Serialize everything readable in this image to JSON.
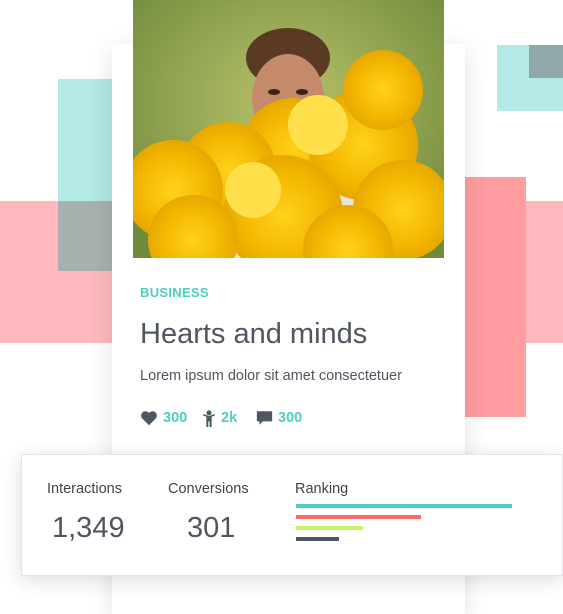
{
  "article": {
    "category": "BUSINESS",
    "title": "Hearts and minds",
    "subtitle": "Lorem ipsum dolor sit amet consectetuer",
    "stats": [
      {
        "icon": "heart-icon",
        "value": "300"
      },
      {
        "icon": "person-icon",
        "value": "2k"
      },
      {
        "icon": "comment-icon",
        "value": "300"
      }
    ]
  },
  "metrics": {
    "interactions_label": "Interactions",
    "interactions_value": "1,349",
    "conversions_label": "Conversions",
    "conversions_value": "301",
    "ranking_label": "Ranking",
    "ranking_bars": [
      {
        "level": 1.0,
        "color": "#4ecdc4"
      },
      {
        "level": 0.58,
        "color": "#ff6b6b"
      },
      {
        "level": 0.31,
        "color": "#c7f464"
      },
      {
        "level": 0.2,
        "color": "#4f5660"
      }
    ]
  },
  "colors": {
    "accent": "#4ecdc4",
    "text": "#4f5660",
    "deco_teal": "#b3e9e6",
    "deco_pink": "#ffb9bc",
    "deco_pink_overlap": "#ff9da1"
  }
}
